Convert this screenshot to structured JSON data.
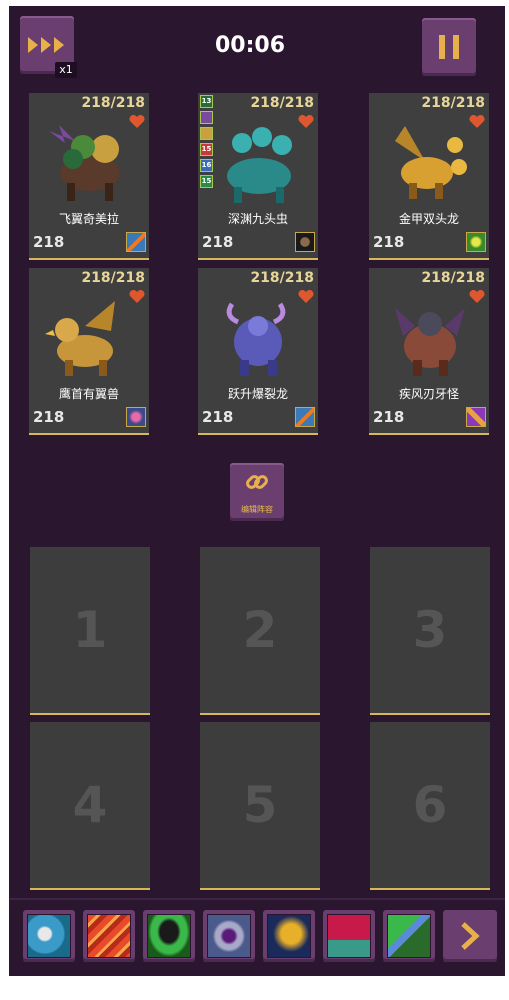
{
  "header": {
    "timer": "00:06",
    "speed_badge": "x1",
    "speed_icon": "fast-forward-icon",
    "pause_icon": "pause-icon"
  },
  "team": [
    {
      "name": "飞翼奇美拉",
      "hp": "218/218",
      "attack": "218",
      "skill_icon": "slash-skill-icon",
      "sprite": "winged-chimera"
    },
    {
      "name": "深渊九头虫",
      "hp": "218/218",
      "attack": "218",
      "skill_icon": "dark-face-skill-icon",
      "sprite": "abyss-hydra",
      "buffs": [
        "13",
        "",
        "",
        "15",
        "16",
        "15"
      ]
    },
    {
      "name": "金甲双头龙",
      "hp": "218/218",
      "attack": "218",
      "skill_icon": "green-burst-skill-icon",
      "sprite": "golden-twin-dragon"
    },
    {
      "name": "鹰首有翼兽",
      "hp": "218/218",
      "attack": "218",
      "skill_icon": "pink-orb-skill-icon",
      "sprite": "griffin"
    },
    {
      "name": "跃升爆裂龙",
      "hp": "218/218",
      "attack": "218",
      "skill_icon": "slash-skill-icon",
      "sprite": "burst-dragon"
    },
    {
      "name": "疾风刃牙怪",
      "hp": "218/218",
      "attack": "218",
      "skill_icon": "claw-skill-icon",
      "sprite": "gale-fang-beast"
    }
  ],
  "edit_button": {
    "label": "编辑阵容",
    "icon": "link-icon"
  },
  "slots": [
    "1",
    "2",
    "3",
    "4",
    "5",
    "6"
  ],
  "abilities": [
    "pearl-clam-icon",
    "fire-claw-icon",
    "tornado-icon",
    "purple-vortex-icon",
    "golden-ghost-icon",
    "crimson-pool-icon",
    "staff-strike-icon"
  ],
  "next_icon": "chevron-right-icon",
  "colors": {
    "background": "#2b1630",
    "button": "#6a3e6e",
    "accent": "#e8b04a",
    "card": "#3f3f3f",
    "heart": "#e0562e"
  }
}
